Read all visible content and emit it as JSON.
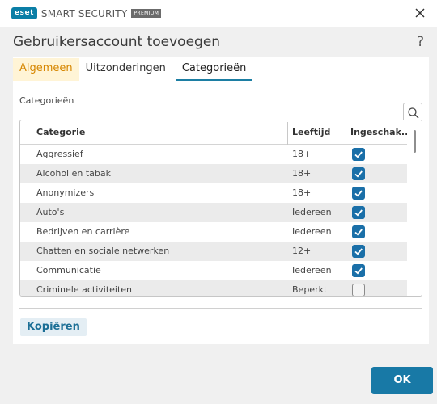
{
  "window": {
    "brand_logo": "eset",
    "product_name": "SMART SECURITY",
    "edition": "PREMIUM",
    "close_icon": "close-icon"
  },
  "dialog": {
    "title": "Gebruikersaccount toevoegen",
    "help": "?"
  },
  "tabs": [
    {
      "label": "Algemeen"
    },
    {
      "label": "Uitzonderingen"
    },
    {
      "label": "Categorieën"
    }
  ],
  "section_label": "Categorieën",
  "table": {
    "headers": {
      "category": "Categorie",
      "age": "Leeftijd",
      "enabled": "Ingeschak..."
    },
    "rows": [
      {
        "category": "Aggressief",
        "age": "18+",
        "enabled": true
      },
      {
        "category": "Alcohol en tabak",
        "age": "18+",
        "enabled": true
      },
      {
        "category": "Anonymizers",
        "age": "18+",
        "enabled": true
      },
      {
        "category": "Auto's",
        "age": "Iedereen",
        "enabled": true
      },
      {
        "category": "Bedrijven en carrière",
        "age": "Iedereen",
        "enabled": true
      },
      {
        "category": "Chatten en sociale netwerken",
        "age": "12+",
        "enabled": true
      },
      {
        "category": "Communicatie",
        "age": "Iedereen",
        "enabled": true
      },
      {
        "category": "Criminele activiteiten",
        "age": "Beperkt",
        "enabled": false
      }
    ]
  },
  "buttons": {
    "copy": "Kopiëren",
    "ok": "OK"
  },
  "colors": {
    "accent": "#1879a6",
    "tab_highlight": "#d68600",
    "checkbox_on": "#1a6fa8"
  }
}
